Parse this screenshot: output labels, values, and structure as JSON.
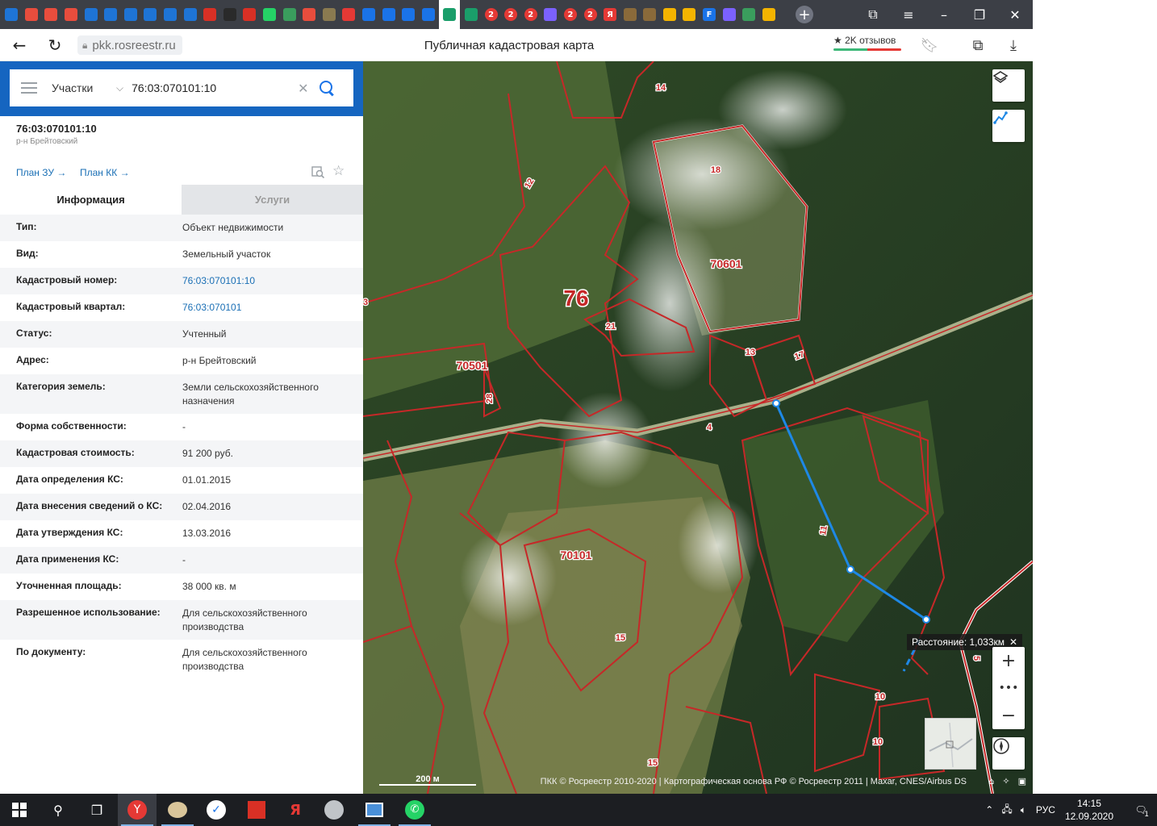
{
  "browser": {
    "url": "pkk.rosreestr.ru",
    "page_title": "Публичная кадастровая карта",
    "reviews_label": "★ 2K отзывов",
    "tabs": [
      {
        "icon": "mail-icon",
        "color": "#1e74d6"
      },
      {
        "icon": "yandex-browser-icon",
        "color": "#e84d3d"
      },
      {
        "icon": "yandex-browser-icon",
        "color": "#e84d3d"
      },
      {
        "icon": "yandex-browser-icon",
        "color": "#e84d3d"
      },
      {
        "icon": "mail-icon",
        "color": "#1e74d6"
      },
      {
        "icon": "mail-icon",
        "color": "#1e74d6"
      },
      {
        "icon": "mail-icon",
        "color": "#1e74d6"
      },
      {
        "icon": "mail-icon",
        "color": "#1e74d6"
      },
      {
        "icon": "mail-icon",
        "color": "#1e74d6"
      },
      {
        "icon": "mail-icon",
        "color": "#1e74d6"
      },
      {
        "icon": "red-tab-icon",
        "color": "#d93025"
      },
      {
        "icon": "star-tab-icon",
        "color": "#2a2a2a"
      },
      {
        "icon": "red-tab-icon",
        "color": "#d93025"
      },
      {
        "icon": "whatsapp-icon",
        "color": "#25d366"
      },
      {
        "icon": "green-tab-icon",
        "color": "#3a9d5d"
      },
      {
        "icon": "yandex-browser-icon",
        "color": "#e84d3d"
      },
      {
        "icon": "picture-tab-icon",
        "color": "#8a7a50"
      },
      {
        "icon": "map-pin-icon",
        "color": "#e53935"
      },
      {
        "icon": "arrow-tab-icon",
        "color": "#1a73e8"
      },
      {
        "icon": "arrow-tab-icon",
        "color": "#1a73e8"
      },
      {
        "icon": "arrow-tab-icon",
        "color": "#1a73e8"
      },
      {
        "icon": "arrow-tab-icon",
        "color": "#1a73e8"
      },
      {
        "icon": "rosreestr-icon",
        "color": "#1a9e6a",
        "active": true
      },
      {
        "icon": "rosreestr-icon",
        "color": "#1a9e6a"
      },
      {
        "icon": "badge-2-icon",
        "color": "#e53935",
        "text": "2"
      },
      {
        "icon": "badge-2-icon",
        "color": "#e53935",
        "text": "2"
      },
      {
        "icon": "badge-2-icon",
        "color": "#e53935",
        "text": "2"
      },
      {
        "icon": "dots-tab-icon",
        "color": "#7b61ff"
      },
      {
        "icon": "badge-2-icon",
        "color": "#e53935",
        "text": "2"
      },
      {
        "icon": "badge-2-icon",
        "color": "#e53935",
        "text": "2"
      },
      {
        "icon": "yandex-icon",
        "color": "#e53935",
        "text": "Я"
      },
      {
        "icon": "house-tab-icon",
        "color": "#8a6a3a"
      },
      {
        "icon": "house-tab-icon",
        "color": "#8a6a3a"
      },
      {
        "icon": "image-tab-icon",
        "color": "#f4b400"
      },
      {
        "icon": "play-tab-icon",
        "color": "#f4b400"
      },
      {
        "icon": "f-tab-icon",
        "color": "#1a73e8",
        "text": "F"
      },
      {
        "icon": "sparkle-tab-icon",
        "color": "#7b61ff"
      },
      {
        "icon": "mountain-tab-icon",
        "color": "#3a9d5d"
      },
      {
        "icon": "home-tab-icon",
        "color": "#f4b400"
      }
    ]
  },
  "panel": {
    "search_type": "Участки",
    "search_value": "76:03:070101:10",
    "object_title": "76:03:070101:10",
    "object_subtitle": "р-н Брейтовский",
    "plan_zu": "План ЗУ →",
    "plan_kk": "План КК →",
    "tab_info": "Информация",
    "tab_services": "Услуги",
    "rows": [
      {
        "key": "Тип:",
        "value": "Объект недвижимости",
        "link": false
      },
      {
        "key": "Вид:",
        "value": "Земельный участок",
        "link": false
      },
      {
        "key": "Кадастровый номер:",
        "value": "76:03:070101:10",
        "link": true
      },
      {
        "key": "Кадастровый квартал:",
        "value": "76:03:070101",
        "link": true
      },
      {
        "key": "Статус:",
        "value": "Учтенный",
        "link": false
      },
      {
        "key": "Адрес:",
        "value": "р-н Брейтовский",
        "link": false
      },
      {
        "key": "Категория земель:",
        "value": "Земли сельскохозяйственного назначения",
        "link": false
      },
      {
        "key": "Форма собственности:",
        "value": "-",
        "link": false
      },
      {
        "key": "Кадастровая стоимость:",
        "value": "91 200 руб.",
        "link": false
      },
      {
        "key": "Дата определения КС:",
        "value": "01.01.2015",
        "link": false
      },
      {
        "key": "Дата внесения сведений о КС:",
        "value": "02.04.2016",
        "link": false
      },
      {
        "key": "Дата утверждения КС:",
        "value": "13.03.2016",
        "link": false
      },
      {
        "key": "Дата применения КС:",
        "value": "-",
        "link": false
      },
      {
        "key": "Уточненная площадь:",
        "value": "38 000 кв. м",
        "link": false
      },
      {
        "key": "Разрешенное использование:",
        "value": "Для сельскохозяйственного производства",
        "link": false
      },
      {
        "key": "По документу:",
        "value": "Для сельскохозяйственного производства",
        "link": false
      }
    ]
  },
  "map": {
    "labels": [
      {
        "text": "14",
        "kind": "small"
      },
      {
        "text": "18",
        "kind": "small"
      },
      {
        "text": "12",
        "kind": "small"
      },
      {
        "text": "70601",
        "kind": "mid"
      },
      {
        "text": "76",
        "kind": "big"
      },
      {
        "text": "21",
        "kind": "small"
      },
      {
        "text": "13",
        "kind": "small"
      },
      {
        "text": "17",
        "kind": "small"
      },
      {
        "text": "70501",
        "kind": "mid"
      },
      {
        "text": "28",
        "kind": "small"
      },
      {
        "text": "4",
        "kind": "small"
      },
      {
        "text": "11",
        "kind": "small"
      },
      {
        "text": "70101",
        "kind": "mid"
      },
      {
        "text": "15",
        "kind": "small"
      },
      {
        "text": "10",
        "kind": "small"
      },
      {
        "text": "10",
        "kind": "small"
      },
      {
        "text": "15",
        "kind": "small"
      },
      {
        "text": "3",
        "kind": "small"
      },
      {
        "text": "5",
        "kind": "small"
      }
    ],
    "distance_label": "Расстояние: 1,033км",
    "scale_label": "200 м",
    "attribution": "ПКК © Росреестр 2010-2020 | Картографическая основа РФ © Росреестр 2011 | Maxar, CNES/Airbus DS",
    "parcel_color": "#c62828",
    "measure_color": "#1e88e5"
  },
  "taskbar": {
    "language": "РУС",
    "time": "14:15",
    "date": "12.09.2020",
    "notifications": "1"
  }
}
